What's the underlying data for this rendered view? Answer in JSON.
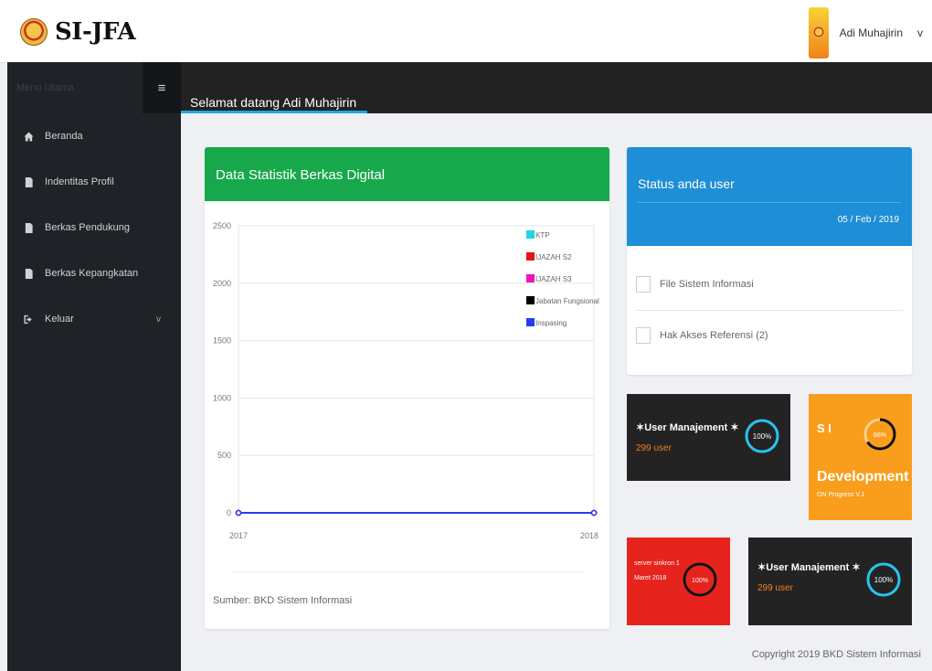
{
  "header": {
    "app_title": "SI-JFA",
    "user_name": "Adi Muhajirin",
    "caret": "v"
  },
  "sidebar": {
    "menu_title": "Menu Utama",
    "toggle": "≡",
    "items": [
      {
        "label": "Beranda",
        "icon": "home-icon"
      },
      {
        "label": "Indentitas Profil",
        "icon": "file-icon"
      },
      {
        "label": "Berkas Pendukung",
        "icon": "file-icon"
      },
      {
        "label": "Berkas Kepangkatan",
        "icon": "file-icon"
      },
      {
        "label": "Keluar",
        "icon": "signout-icon",
        "chevron": "v"
      }
    ]
  },
  "page": {
    "greeting": "Selamat datang Adi Muhajirin"
  },
  "chart_card": {
    "title": "Data Statistik Berkas Digital",
    "source": "Sumber: BKD Sistem Informasi"
  },
  "chart_data": {
    "type": "line",
    "title": "",
    "categories": [
      "2017",
      "2018"
    ],
    "ylim": [
      0,
      2500
    ],
    "yticks": [
      0,
      500,
      1000,
      1500,
      2000,
      2500
    ],
    "grid": true,
    "legend_position": "top-right",
    "series": [
      {
        "name": "KTP",
        "color": "#22d3e6",
        "values": [
          0,
          0
        ]
      },
      {
        "name": "IJAZAH S2",
        "color": "#e8141a",
        "values": [
          0,
          0
        ]
      },
      {
        "name": "IJAZAH S3",
        "color": "#f012be",
        "values": [
          0,
          0
        ]
      },
      {
        "name": "Jabatan Fungsional",
        "color": "#000000",
        "values": [
          0,
          0
        ]
      },
      {
        "name": "Inspasing",
        "color": "#2b3cf0",
        "values": [
          0,
          0
        ]
      }
    ]
  },
  "status_card": {
    "title": "Status anda user",
    "date": "05 / Feb / 2019",
    "items": [
      {
        "label": "File Sistem Informasi"
      },
      {
        "label": "Hak Akses Referensi (2)"
      }
    ]
  },
  "tiles": {
    "user_mgmt_1": {
      "title": "✶User Manajement ✶",
      "sub": "299 user",
      "percent": "100%",
      "progress": 1.0
    },
    "si_dev": {
      "title": "S I",
      "title2": "Development",
      "sub": "ON Progress V.1",
      "percent": "66%",
      "progress": 0.66
    },
    "server": {
      "line1": "server sinkron 1",
      "line2": "Maret 2018",
      "percent": "100%",
      "progress": 1.0
    },
    "user_mgmt_2": {
      "title": "✶User Manajement ✶",
      "sub": "299 user",
      "percent": "100%",
      "progress": 1.0
    }
  },
  "footer": {
    "copyright": "Copyright 2019 BKD Sistem Informasi"
  },
  "colors": {
    "accent": "#27a4e0",
    "chart_header": "#18a84c",
    "status_header": "#1e8ed6",
    "orange": "#f99d1c",
    "red": "#e6231c",
    "ring_blue": "#27c3ef"
  }
}
